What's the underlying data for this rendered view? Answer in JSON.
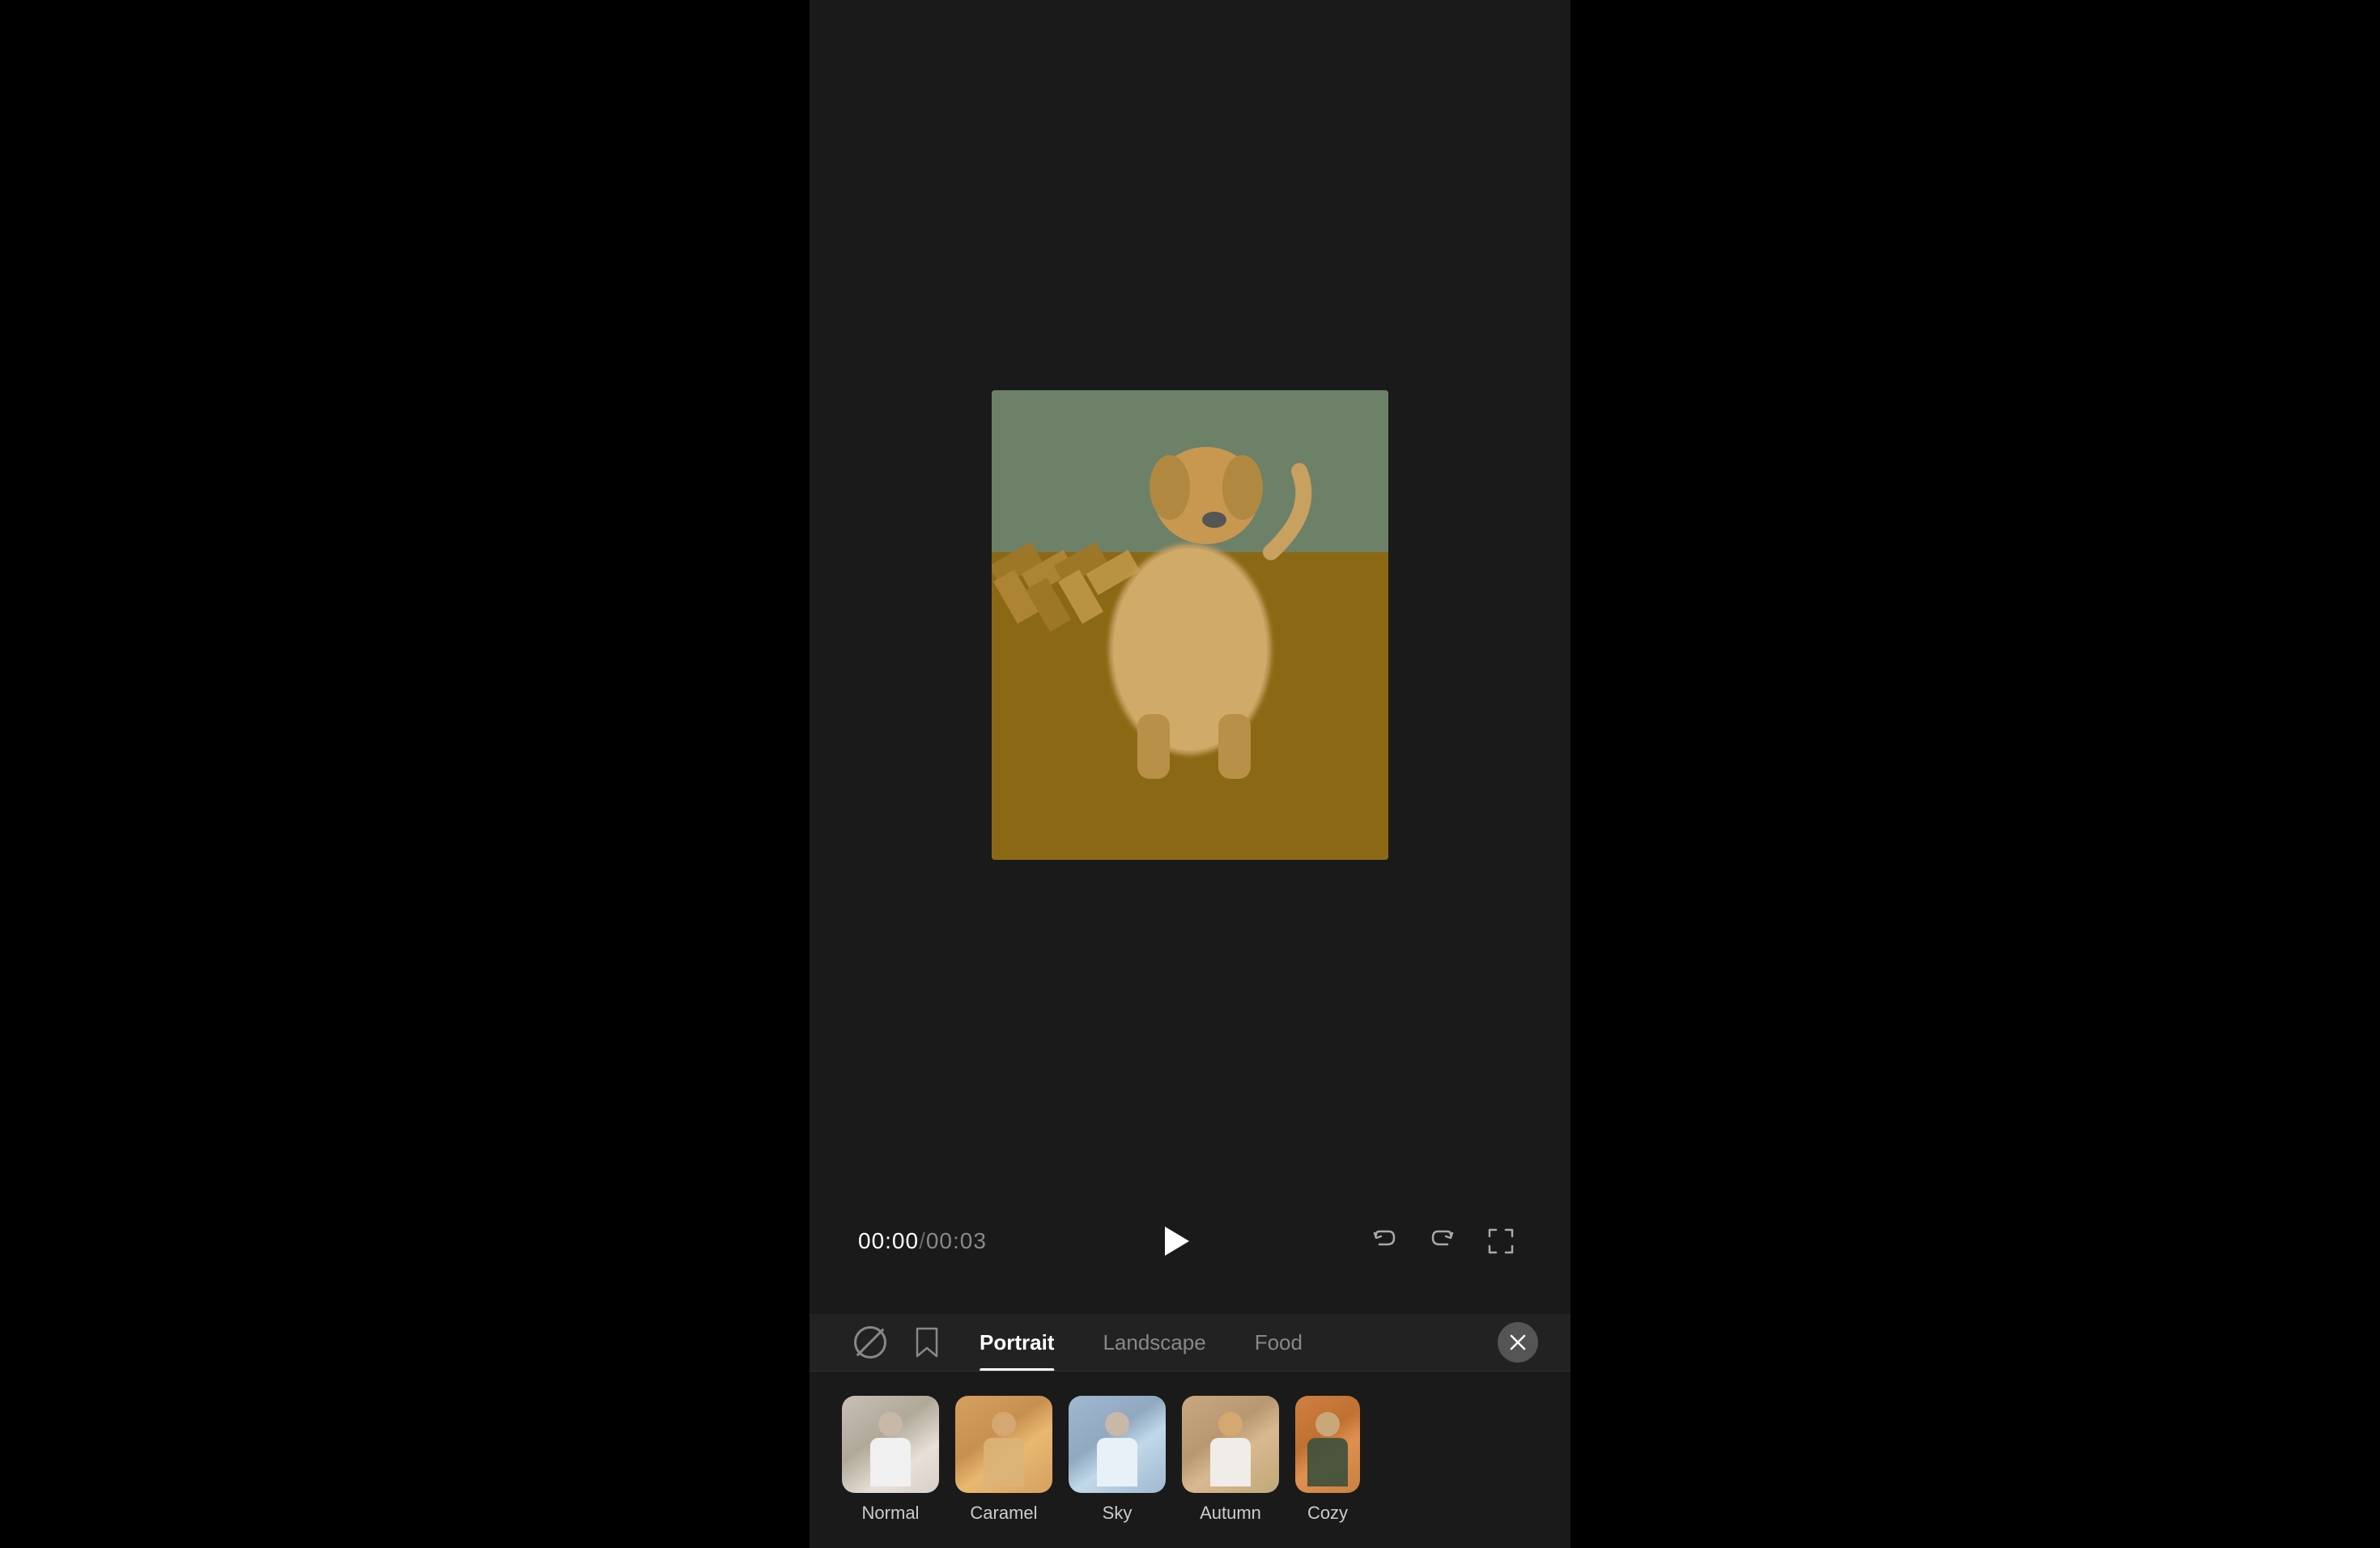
{
  "app": {
    "bg_color": "#1a1a1a"
  },
  "video": {
    "current_time": "00:00",
    "total_time": "00:03",
    "separator": "/"
  },
  "controls": {
    "play_label": "Play",
    "undo_label": "Undo",
    "redo_label": "Redo",
    "fullscreen_label": "Fullscreen"
  },
  "tabs": {
    "no_filter_label": "No Filter",
    "bookmark_label": "Saved",
    "items": [
      {
        "id": "portrait",
        "label": "Portrait",
        "active": true
      },
      {
        "id": "landscape",
        "label": "Landscape",
        "active": false
      },
      {
        "id": "food",
        "label": "Food",
        "active": false
      }
    ],
    "close_label": "Close"
  },
  "filters": [
    {
      "id": "normal",
      "label": "Normal",
      "style": "normal"
    },
    {
      "id": "caramel",
      "label": "Caramel",
      "style": "caramel"
    },
    {
      "id": "sky",
      "label": "Sky",
      "style": "sky"
    },
    {
      "id": "autumn",
      "label": "Autumn",
      "style": "autumn"
    },
    {
      "id": "cozy",
      "label": "Cozy",
      "style": "cozy"
    }
  ]
}
